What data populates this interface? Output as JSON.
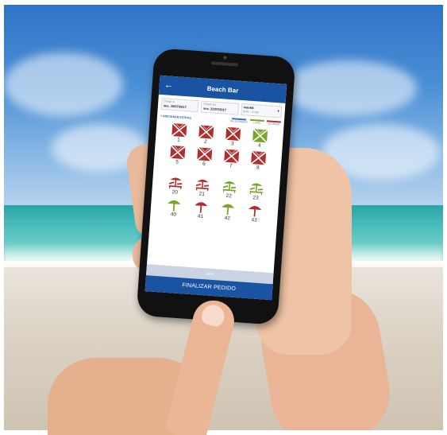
{
  "app": {
    "title": "Beach Bar",
    "back_icon": "arrow-left-icon"
  },
  "booking": {
    "checkin_label": "Check in",
    "checkin_value": "sex. 15/07/2017",
    "checkout_label": "Check out",
    "checkout_value": "sex. 22/07/2017",
    "period_label": "manhã",
    "period_value": "8:00 – 13:00"
  },
  "extras_link": "+ ADICIONAR EXTRAS",
  "legend": [
    {
      "label": "SELECIONADO",
      "color": "#2f6fc0"
    },
    {
      "label": "LIVRE",
      "color": "#7aa52a"
    },
    {
      "label": "OCUPADO",
      "color": "#b02e2e"
    }
  ],
  "colors": {
    "primary": "#1b53a3",
    "occupied": "#b02e2e",
    "free": "#7aa52a"
  },
  "tents": [
    {
      "number": "1",
      "status": "occupied"
    },
    {
      "number": "2",
      "status": "occupied"
    },
    {
      "number": "3",
      "status": "occupied"
    },
    {
      "number": "4",
      "status": "free"
    },
    {
      "number": "5",
      "status": "occupied"
    },
    {
      "number": "6",
      "status": "occupied"
    },
    {
      "number": "7",
      "status": "occupied"
    },
    {
      "number": "8",
      "status": "occupied"
    }
  ],
  "sunbeds": [
    {
      "number": "20",
      "status": "occupied"
    },
    {
      "number": "21",
      "status": "occupied"
    },
    {
      "number": "22",
      "status": "free"
    },
    {
      "number": "23",
      "status": "free"
    }
  ],
  "umbrellas": [
    {
      "number": "40",
      "status": "free"
    },
    {
      "number": "41",
      "status": "occupied"
    },
    {
      "number": "42",
      "status": "free"
    },
    {
      "number": "43",
      "status": "occupied"
    }
  ],
  "save_label": "SAVE",
  "finish_label": "FINALIZAR PEDIDO"
}
